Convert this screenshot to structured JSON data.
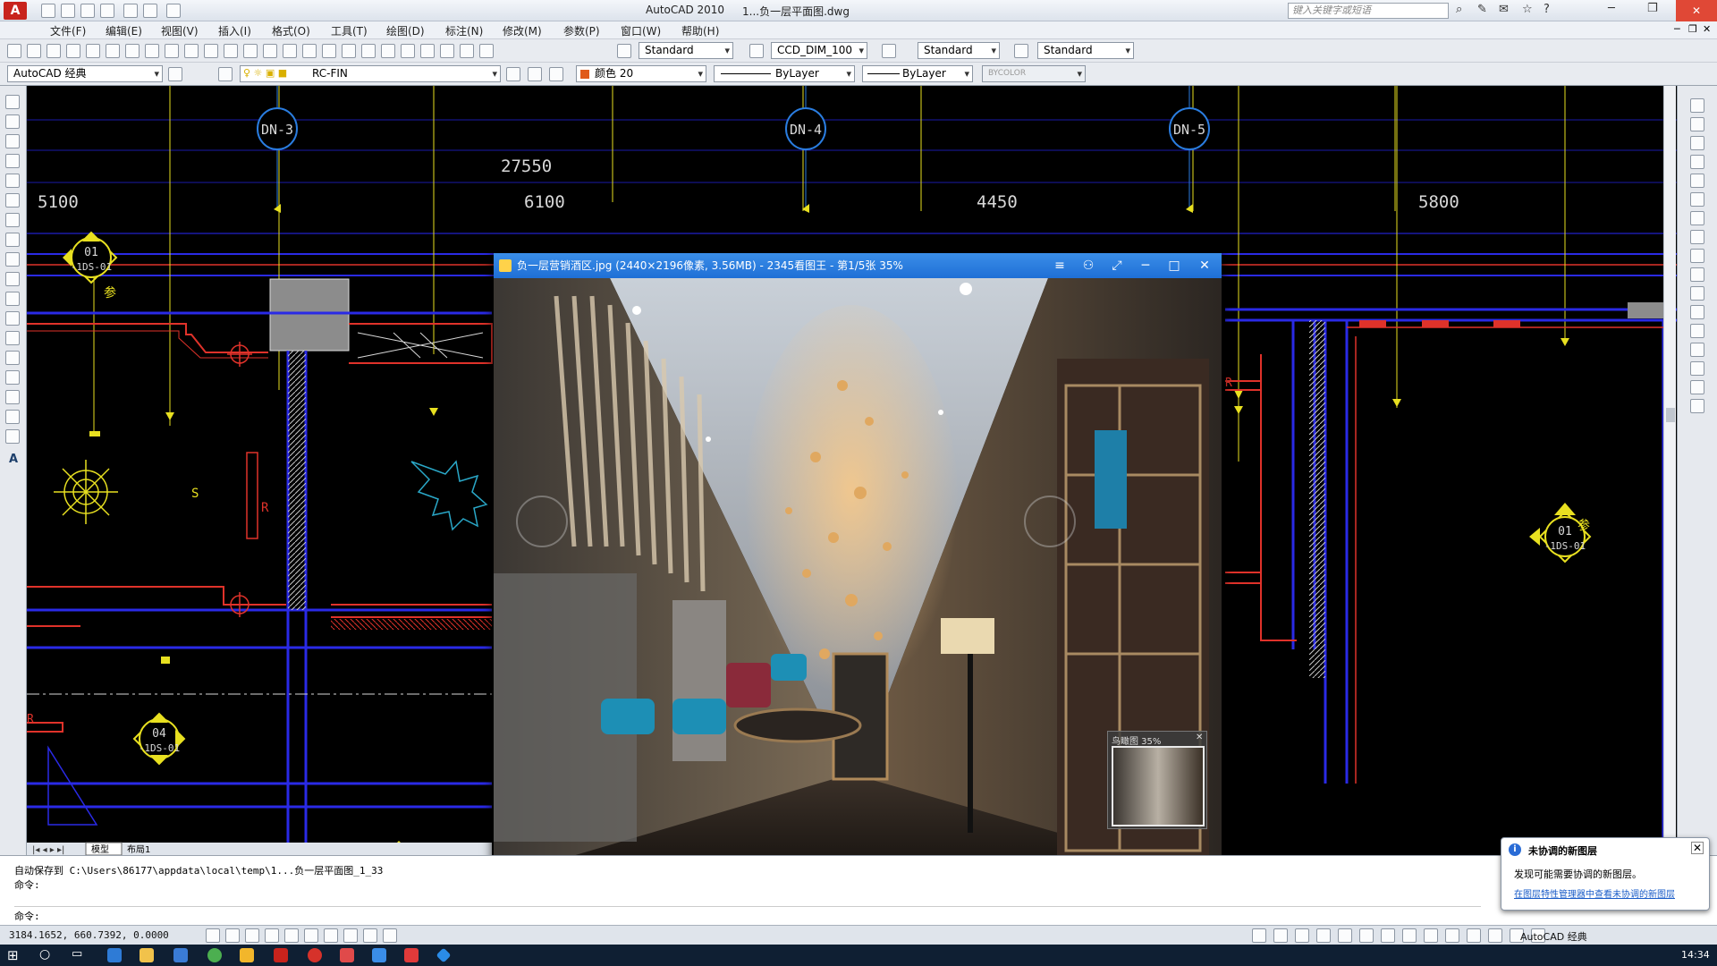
{
  "titlebar": {
    "app_title": "AutoCAD 2010",
    "file_title": "1...负一层平面图.dwg",
    "search_placeholder": "键入关键字或短语"
  },
  "menu": [
    "文件(F)",
    "编辑(E)",
    "视图(V)",
    "插入(I)",
    "格式(O)",
    "工具(T)",
    "绘图(D)",
    "标注(N)",
    "修改(M)",
    "参数(P)",
    "窗口(W)",
    "帮助(H)"
  ],
  "toolbar1": {
    "text_style": "Standard",
    "dim_style": "CCD_DIM_100",
    "table_style": "Standard",
    "mleader_style": "Standard"
  },
  "toolbar2": {
    "workspace": "AutoCAD 经典",
    "layer": "RC-FIN",
    "color": "颜色 20",
    "linetype": "ByLayer",
    "lineweight": "ByLayer",
    "plotstyle": "BYCOLOR"
  },
  "drawing": {
    "tags": [
      "DN-3",
      "DN-4",
      "DN-5"
    ],
    "overall_dim": "27550",
    "dims": [
      "5100",
      "6100",
      "4450",
      "5800"
    ],
    "symbols": [
      {
        "top": "01",
        "bottom": "-1DS-01",
        "note": "参"
      },
      {
        "top": "01",
        "bottom": "-1DS-01",
        "note": "参"
      },
      {
        "top": "04",
        "bottom": "-1DS-01",
        "note": ""
      }
    ],
    "marker_labels": [
      "S",
      "R",
      "R",
      "R"
    ]
  },
  "layout_tabs": [
    "模型",
    "布局1"
  ],
  "viewer": {
    "title": "负一层营销酒区.jpg (2440×2196像素, 3.56MB) - 2345看图王 - 第1/5张 35%",
    "nav_title": "鸟瞰图 35%",
    "buttons": [
      "menu",
      "restore",
      "fullscreen",
      "minimize",
      "maximize",
      "close"
    ]
  },
  "command": {
    "line1": "自动保存到 C:\\Users\\86177\\appdata\\local\\temp\\1...负一层平面图_1_33",
    "line2": "命令:",
    "line3": "命令:"
  },
  "status": {
    "coords": "3184.1652, 660.7392, 0.0000",
    "workspace": "AutoCAD 经典"
  },
  "notification": {
    "title": "未协调的新图层",
    "body": "发现可能需要协调的新图层。",
    "link": "在图层特性管理器中查看未协调的新图层"
  },
  "taskbar": {
    "time": "14:34"
  },
  "colors": {
    "cad_background": "#000000",
    "wall_blue": "#2a2ae6",
    "wall_red": "#e0322a",
    "dim_yellow": "#e8e020",
    "viewer_blue": "#2a7de0"
  }
}
